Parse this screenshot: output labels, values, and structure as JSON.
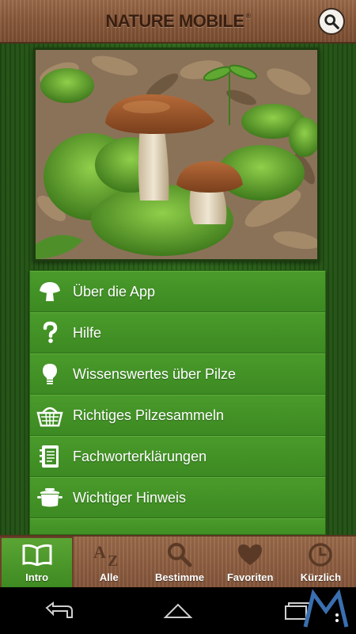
{
  "header": {
    "brand_name": "NATURE MOBILE",
    "brand_mark": "®",
    "search_icon": "search-icon"
  },
  "photo": {
    "subject": "mushroom-photo"
  },
  "menu": {
    "items": [
      {
        "label": "Über die App",
        "icon": "mushroom-icon"
      },
      {
        "label": "Hilfe",
        "icon": "question-icon"
      },
      {
        "label": "Wissenswertes über Pilze",
        "icon": "lightbulb-icon"
      },
      {
        "label": "Richtiges Pilzesammeln",
        "icon": "basket-icon"
      },
      {
        "label": "Fachworterklärungen",
        "icon": "notebook-icon"
      },
      {
        "label": "Wichtiger Hinweis",
        "icon": "pot-icon"
      }
    ]
  },
  "tabs": [
    {
      "label": "Intro",
      "icon": "book-icon",
      "active": true
    },
    {
      "label": "Alle",
      "icon": "az-sort-icon",
      "active": false
    },
    {
      "label": "Bestimme",
      "icon": "magnifier-icon",
      "active": false
    },
    {
      "label": "Favoriten",
      "icon": "heart-icon",
      "active": false
    },
    {
      "label": "Kürzlich",
      "icon": "clock-icon",
      "active": false
    }
  ],
  "colors": {
    "menu_green": "#3f8f24",
    "wood_brown": "#8a5a3b",
    "active_tab_green": "#4c9a2c"
  }
}
